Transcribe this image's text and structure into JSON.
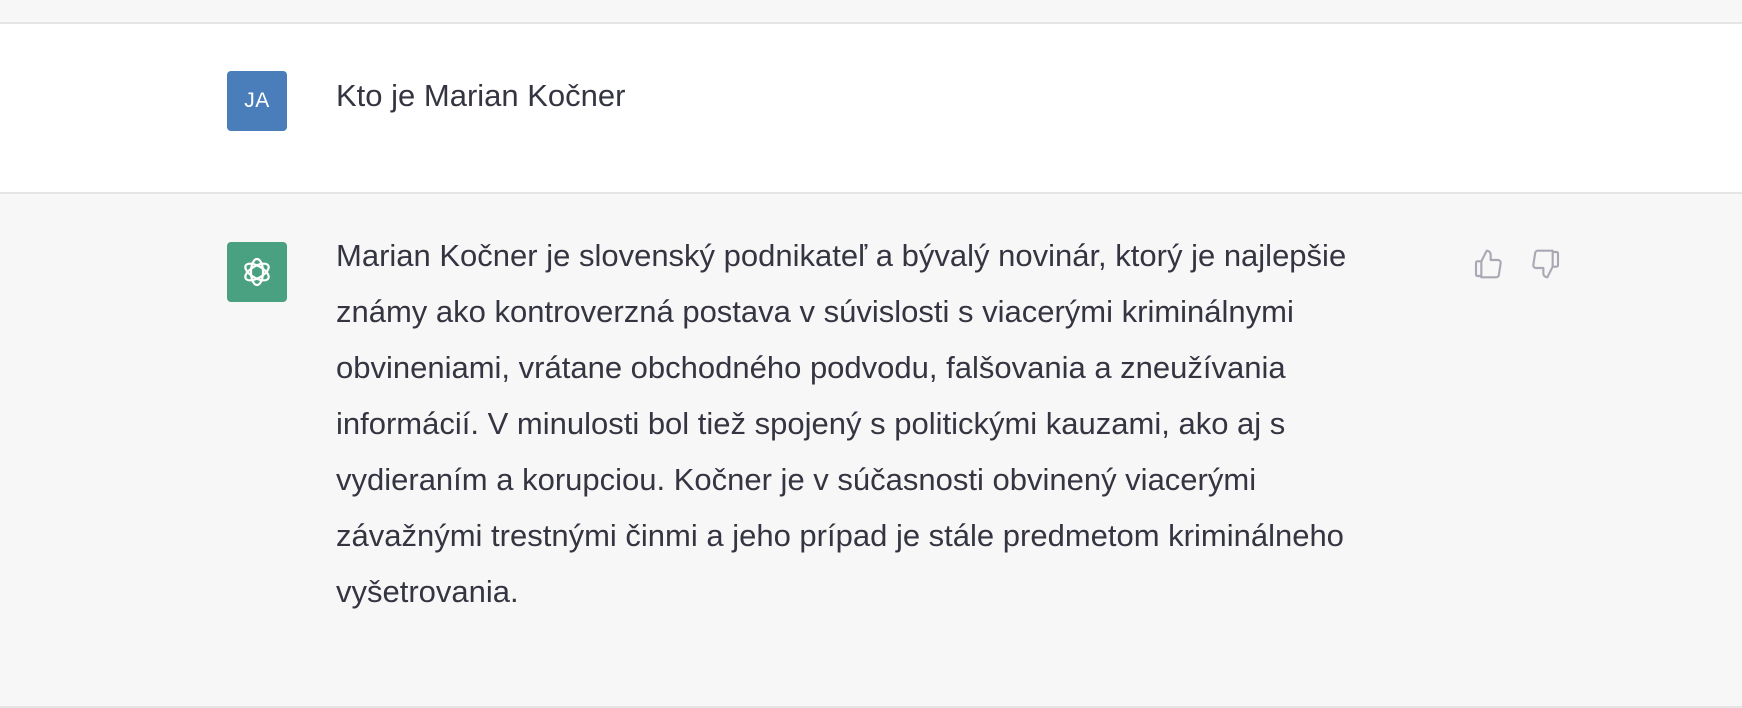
{
  "user_message": {
    "avatar_initials": "JA",
    "text": "Kto je Marian Kočner"
  },
  "assistant_message": {
    "avatar_icon": "openai-logo-icon",
    "text": "Marian Kočner je slovenský podnikateľ a bývalý novinár, ktorý je najlepšie známy ako kontroverzná postava v súvislosti s viacerými kriminálnymi obvineniami, vrátane obchodného podvodu, falšovania a zneužívania informácií. V minulosti bol tiež spojený s politickými kauzami, ako aj s vydieraním a korupciou. Kočner je v súčasnosti obvinený viacerými závažnými trestnými činmi a jeho prípad je stále predmetom kriminálneho vyšetrovania."
  },
  "feedback": {
    "like_icon": "thumbs-up-icon",
    "dislike_icon": "thumbs-down-icon"
  },
  "colors": {
    "user_avatar": "#4a7ebb",
    "bot_avatar": "#4aa182",
    "text": "#343541",
    "icon": "#a9a9b3"
  }
}
